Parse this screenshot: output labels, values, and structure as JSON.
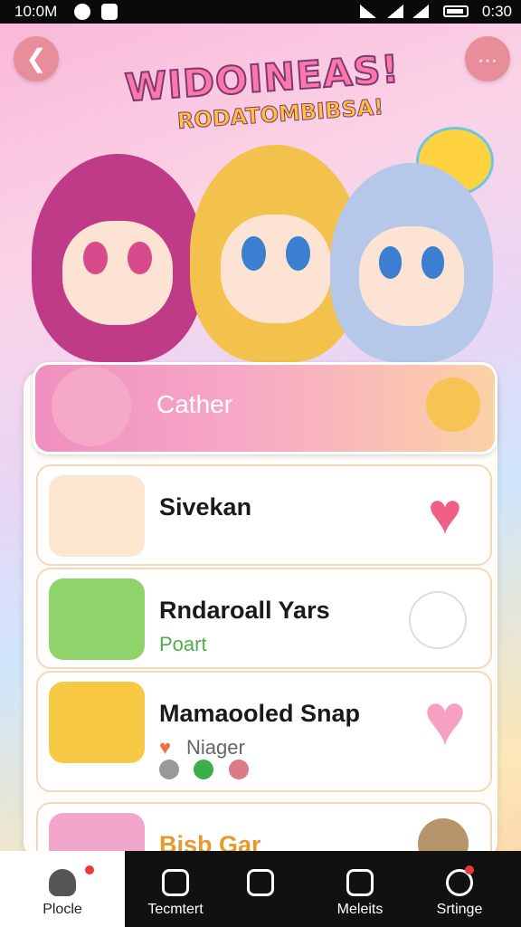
{
  "status_bar": {
    "time": "10:0M",
    "battery": "0:30"
  },
  "header": {
    "back_icon": "arrow-left-icon",
    "more_icon": "dots-icon",
    "title": "WIDOINEAS!",
    "subtitle": "RODATOMBIBSA!"
  },
  "list": {
    "featured": {
      "name": "Cather"
    },
    "items": [
      {
        "name": "Sivekan",
        "subtitle": "",
        "action_icon": "heart-icon"
      },
      {
        "name": "Rndaroall Yars",
        "subtitle": "Poart",
        "action_icon": "ghost-star-icon"
      },
      {
        "name": "Mamaooled Snap",
        "subtitle": "Niager",
        "action_icon": "heart-cloud-icon"
      },
      {
        "name": "Bisb Gar",
        "subtitle": "",
        "action_icon": "bear-icon"
      }
    ]
  },
  "bottom_nav": [
    {
      "label": "Plocle",
      "icon": "profile-icon",
      "active": true
    },
    {
      "label": "Tecmtert",
      "icon": "home-outline-icon",
      "active": false
    },
    {
      "label": "",
      "icon": "home-icon",
      "active": false
    },
    {
      "label": "Meleits",
      "icon": "book-icon",
      "active": false
    },
    {
      "label": "Srtinge",
      "icon": "chat-icon",
      "active": false
    }
  ],
  "colors": {
    "accent": "#f08fc0",
    "heart": "#f05f86",
    "nav_bg": "#111111"
  }
}
